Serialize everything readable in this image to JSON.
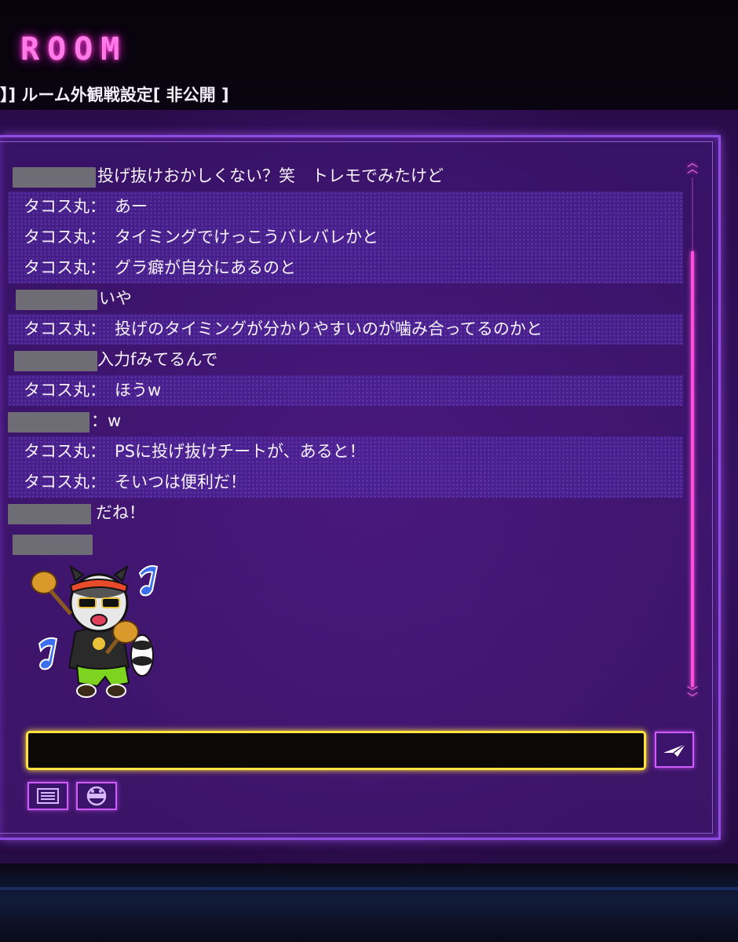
{
  "header": {
    "title": "ROOM",
    "settings_text": "】] ルーム外観戦設定[ 非公開 ]"
  },
  "chat": {
    "messages": [
      {
        "name": "",
        "name_redacted": true,
        "separator": "",
        "text": "投げ抜けおかしくない？笑　トレモでみたけど",
        "highlighted": false
      },
      {
        "name": "タコス丸",
        "name_redacted": false,
        "separator": "：",
        "text": "あー",
        "highlighted": true
      },
      {
        "name": "タコス丸",
        "name_redacted": false,
        "separator": "：",
        "text": "タイミングでけっこうバレバレかと",
        "highlighted": true
      },
      {
        "name": "タコス丸",
        "name_redacted": false,
        "separator": "：",
        "text": "グラ癖が自分にあるのと",
        "highlighted": true
      },
      {
        "name": "",
        "name_redacted": true,
        "separator": "",
        "text": "いや",
        "highlighted": false
      },
      {
        "name": "タコス丸",
        "name_redacted": false,
        "separator": "：",
        "text": "投げのタイミングが分かりやすいのが噛み合ってるのかと",
        "highlighted": true
      },
      {
        "name": "",
        "name_redacted": true,
        "separator": "",
        "text": "入力fみてるんで",
        "highlighted": false
      },
      {
        "name": "タコス丸",
        "name_redacted": false,
        "separator": "：",
        "text": "ほうw",
        "highlighted": true
      },
      {
        "name": "",
        "name_redacted": true,
        "separator": "：",
        "text": "w",
        "highlighted": false
      },
      {
        "name": "タコス丸",
        "name_redacted": false,
        "separator": "：",
        "text": "PSに投げ抜けチートが、あると！",
        "highlighted": true
      },
      {
        "name": "タコス丸",
        "name_redacted": false,
        "separator": "：",
        "text": "そいつは便利だ！",
        "highlighted": true
      },
      {
        "name": "",
        "name_redacted": true,
        "separator": "",
        "text": "だね！",
        "highlighted": false
      },
      {
        "name": "",
        "name_redacted": true,
        "separator": "",
        "text": "",
        "highlighted": false
      }
    ],
    "sticker": "raccoon-maracas-sticker"
  },
  "input": {
    "value": "",
    "placeholder": ""
  },
  "icons": {
    "send": "send-icon",
    "log": "chat-log-icon",
    "stickers": "sticker-icon",
    "scroll_up": "chevron-double-up-icon",
    "scroll_down": "chevron-double-down-icon"
  },
  "colors": {
    "neon_pink": "#ff4fdc",
    "input_border": "#ffe23d",
    "panel_border": "#8f4de0",
    "background": "#3b1366"
  }
}
